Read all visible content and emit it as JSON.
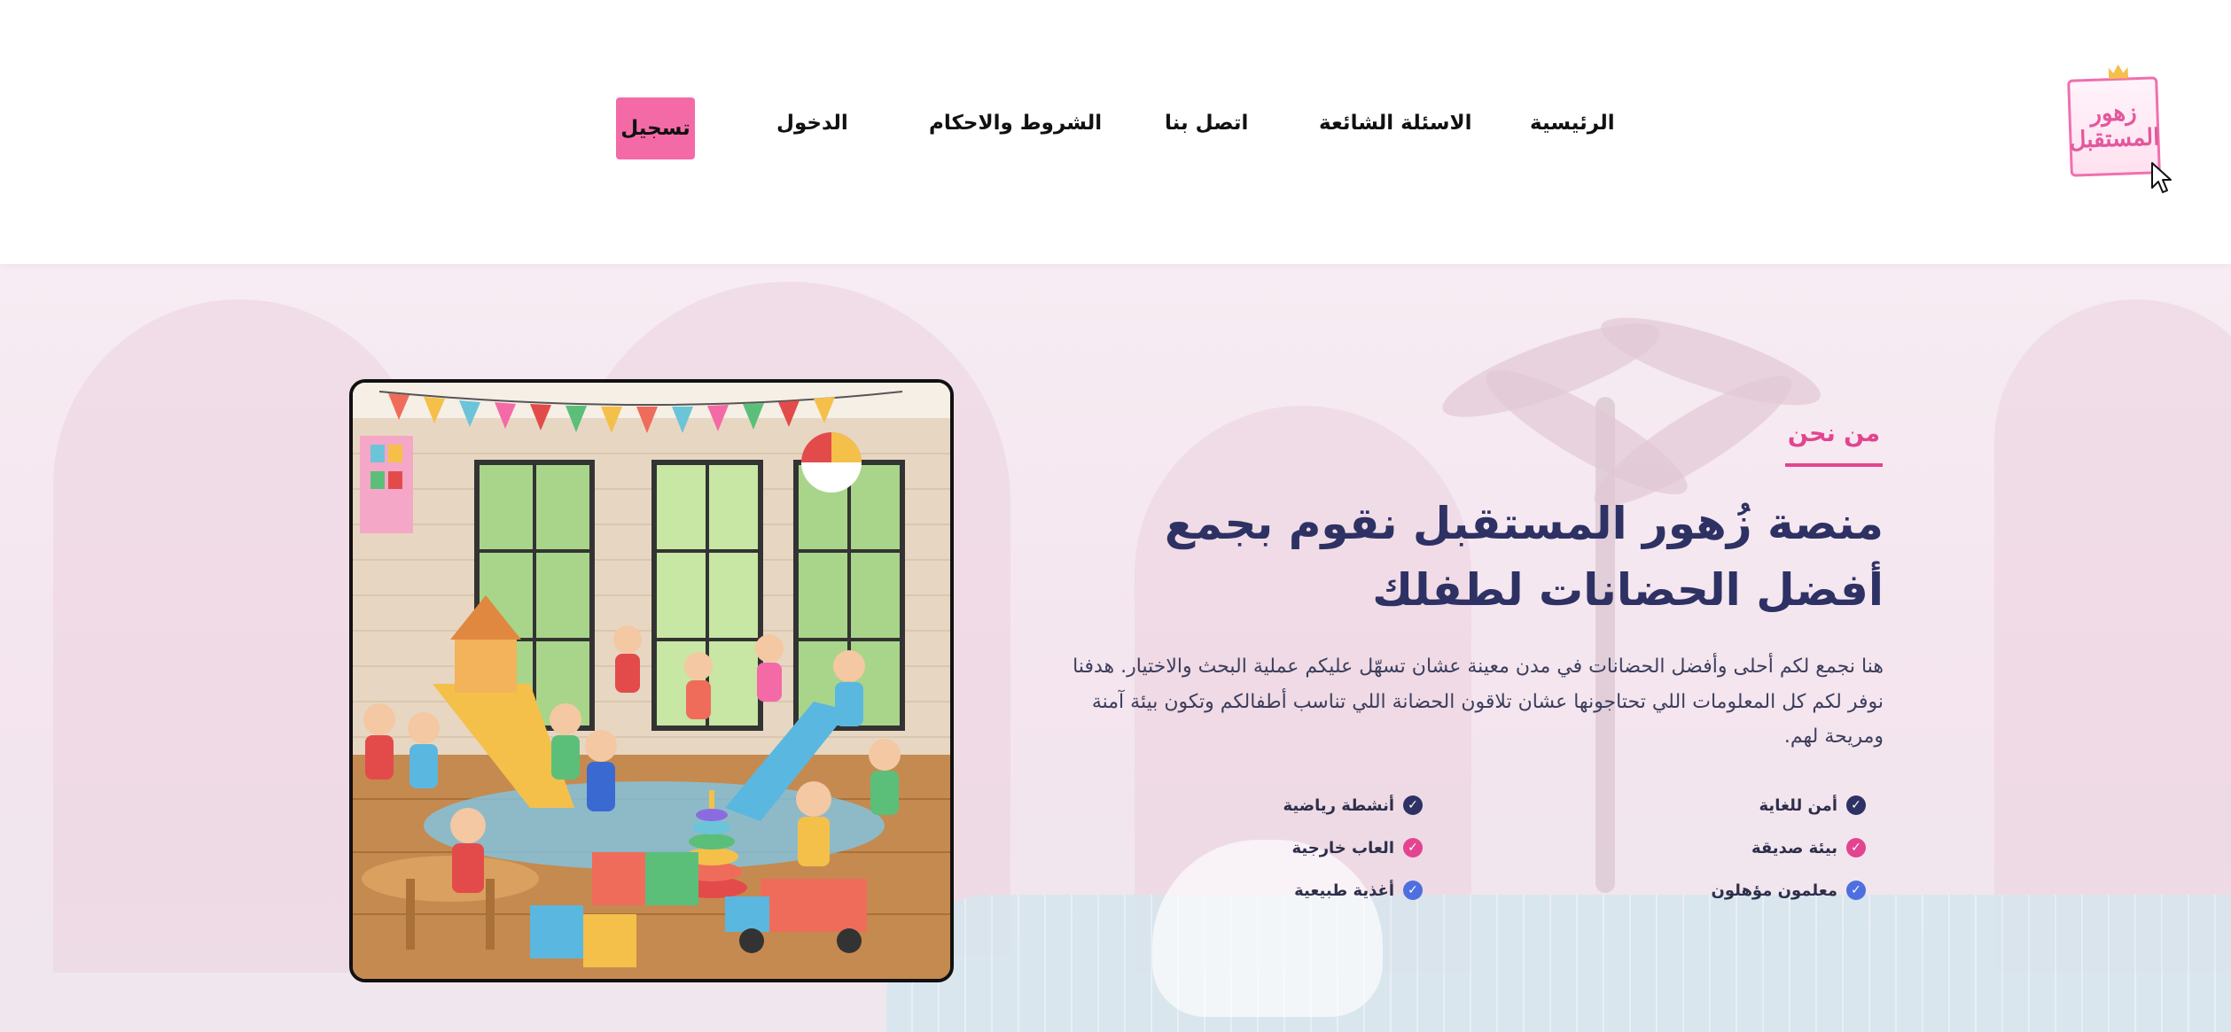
{
  "header": {
    "logo_text": "زهور المستقبل",
    "nav": [
      {
        "label": "الرئيسية"
      },
      {
        "label": "الاسئلة الشائعة"
      },
      {
        "label": "اتصل بنا"
      },
      {
        "label": "الشروط والاحكام"
      },
      {
        "label": "الدخول"
      }
    ],
    "register_label": "تسجيل"
  },
  "about": {
    "section_label": "من نحن",
    "headline": "منصة زُهور المستقبل نقوم بجمع أفضل الحضانات لطفلك",
    "description": "هنا نجمع لكم أحلى وأفضل الحضانات في مدن معينة عشان تسهّل عليكم عملية البحث والاختيار. هدفنا نوفر لكم كل المعلومات اللي تحتاجونها عشان تلاقون الحضانة اللي تناسب أطفالكم وتكون بيئة آمنة ومريحة لهم.",
    "features": [
      {
        "label": "أمن للغاية",
        "color": "#2e3163"
      },
      {
        "label": "أنشطة رياضية",
        "color": "#2e3163"
      },
      {
        "label": "بيئة صديقة",
        "color": "#e3448f"
      },
      {
        "label": "العاب خارجية",
        "color": "#e3448f"
      },
      {
        "label": "معلمون مؤهلون",
        "color": "#4f6fe0"
      },
      {
        "label": "أغذية طبيعية",
        "color": "#4f6fe0"
      }
    ]
  },
  "colors": {
    "accent_pink": "#f46aa7",
    "heading_navy": "#2e3163",
    "label_pink": "#e3448f"
  },
  "icons": {
    "check": "check-circle-icon",
    "cursor": "mouse-pointer-icon"
  }
}
